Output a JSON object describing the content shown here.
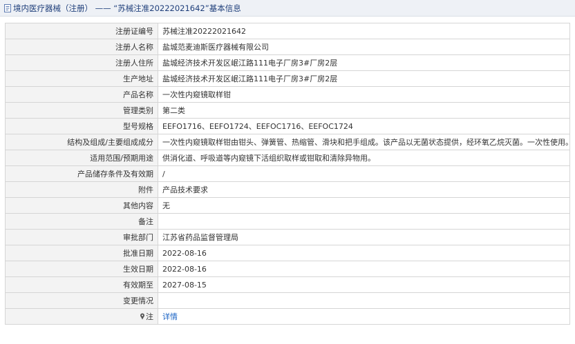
{
  "header": {
    "title": "境内医疗器械（注册） —— “苏械注准20222021642”基本信息",
    "icon": "document-icon"
  },
  "rows": [
    {
      "label": "注册证编号",
      "value": "苏械注准20222021642"
    },
    {
      "label": "注册人名称",
      "value": "盐城范麦迪斯医疗器械有限公司"
    },
    {
      "label": "注册人住所",
      "value": "盐城经济技术开发区岷江路111电子厂房3#厂房2层"
    },
    {
      "label": "生产地址",
      "value": "盐城经济技术开发区岷江路111电子厂房3#厂房2层"
    },
    {
      "label": "产品名称",
      "value": "一次性内窥镜取样钳"
    },
    {
      "label": "管理类别",
      "value": "第二类"
    },
    {
      "label": "型号规格",
      "value": "EEFO1716、EEFO1724、EEFOC1716、EEFOC1724"
    },
    {
      "label": "结构及组成/主要组成成分",
      "value": "一次性内窥镜取样钳由钳头、弹簧管、热缩管、滑块和把手组成。该产品以无菌状态提供，经环氧乙烷灭菌。一次性使用。"
    },
    {
      "label": "适用范围/预期用途",
      "value": "供消化道、呼吸道等内窥镜下活组织取样或钳取和清除异物用。"
    },
    {
      "label": "产品储存条件及有效期",
      "value": "/"
    },
    {
      "label": "附件",
      "value": "产品技术要求"
    },
    {
      "label": "其他内容",
      "value": "无"
    },
    {
      "label": "备注",
      "value": ""
    },
    {
      "label": "审批部门",
      "value": "江苏省药品监督管理局"
    },
    {
      "label": "批准日期",
      "value": "2022-08-16"
    },
    {
      "label": "生效日期",
      "value": "2022-08-16"
    },
    {
      "label": "有效期至",
      "value": "2027-08-15"
    },
    {
      "label": "变更情况",
      "value": ""
    }
  ],
  "note_row": {
    "label": "注",
    "icon": "location-pin-icon",
    "link_text": "详情"
  },
  "colors": {
    "header_bg": "#eef1f6",
    "label_bg": "#f3f3f3",
    "border": "#d5d5d5",
    "link": "#1a63c4",
    "title": "#1e3e7a"
  }
}
